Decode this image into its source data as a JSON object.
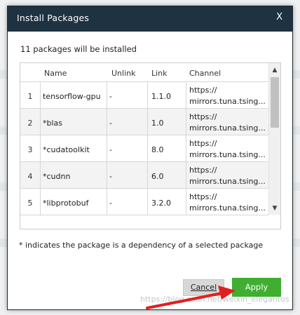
{
  "dialog": {
    "title": "Install Packages",
    "close_label": "X",
    "count_text": "11 packages will be installed",
    "footnote": "* indicates the package is a dependency of a selected package",
    "cancel_label": "Cancel",
    "apply_label": "Apply"
  },
  "table": {
    "headers": {
      "num": "",
      "name": "Name",
      "unlink": "Unlink",
      "link": "Link",
      "channel": "Channel"
    },
    "rows": [
      {
        "num": "1",
        "name": "tensorflow-gpu",
        "unlink": "-",
        "link": "1.1.0",
        "channel_line1": "https://",
        "channel_line2": "mirrors.tuna.tsing..."
      },
      {
        "num": "2",
        "name": "*blas",
        "unlink": "-",
        "link": "1.0",
        "channel_line1": "https://",
        "channel_line2": "mirrors.tuna.tsing..."
      },
      {
        "num": "3",
        "name": "*cudatoolkit",
        "unlink": "-",
        "link": "8.0",
        "channel_line1": "https://",
        "channel_line2": "mirrors.tuna.tsing..."
      },
      {
        "num": "4",
        "name": "*cudnn",
        "unlink": "-",
        "link": "6.0",
        "channel_line1": "https://",
        "channel_line2": "mirrors.tuna.tsing..."
      },
      {
        "num": "5",
        "name": "*libprotobuf",
        "unlink": "-",
        "link": "3.2.0",
        "channel_line1": "https://",
        "channel_line2": "mirrors.tuna.tsing..."
      }
    ]
  },
  "scrollbar": {
    "up_icon": "chevron-up-icon",
    "down_icon": "chevron-down-icon"
  },
  "watermark": "https://blog.csdn.net/weixin_elegantos",
  "colors": {
    "titlebar": "#1f3241",
    "apply": "#3fae31",
    "arrow": "#e02020"
  }
}
